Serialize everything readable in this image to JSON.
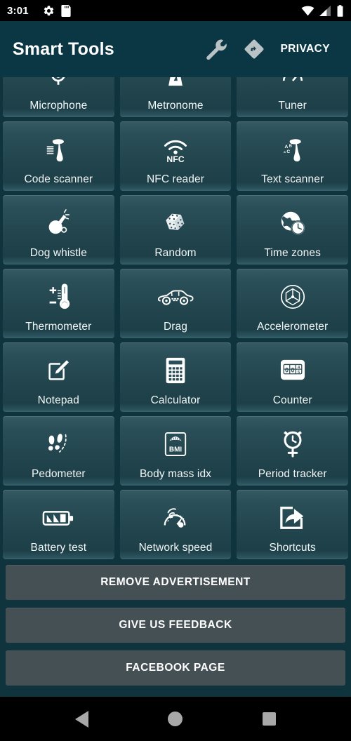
{
  "status_bar": {
    "time": "3:01",
    "left_icons": [
      {
        "name": "settings-gear-icon"
      },
      {
        "name": "sd-card-icon"
      }
    ],
    "right_icons": [
      {
        "name": "wifi-icon"
      },
      {
        "name": "cellular-signal-icon"
      },
      {
        "name": "battery-icon"
      }
    ]
  },
  "app_bar": {
    "title": "Smart Tools",
    "actions": [
      {
        "name": "wrench-icon",
        "label": ""
      },
      {
        "name": "navigation-diamond-icon",
        "label": ""
      }
    ],
    "privacy_label": "PRIVACY"
  },
  "grid": {
    "tiles": [
      {
        "label": "Microphone",
        "icon": "microphone-icon"
      },
      {
        "label": "Metronome",
        "icon": "metronome-icon"
      },
      {
        "label": "Tuner",
        "icon": "tuner-icon"
      },
      {
        "label": "Code scanner",
        "icon": "barcode-scanner-icon"
      },
      {
        "label": "NFC reader",
        "icon": "nfc-icon"
      },
      {
        "label": "Text scanner",
        "icon": "text-scanner-icon"
      },
      {
        "label": "Dog whistle",
        "icon": "whistle-icon"
      },
      {
        "label": "Random",
        "icon": "dice-icon"
      },
      {
        "label": "Time zones",
        "icon": "globe-clock-icon"
      },
      {
        "label": "Thermometer",
        "icon": "thermometer-icon"
      },
      {
        "label": "Drag",
        "icon": "car-icon"
      },
      {
        "label": "Accelerometer",
        "icon": "accelerometer-icon"
      },
      {
        "label": "Notepad",
        "icon": "notepad-pencil-icon"
      },
      {
        "label": "Calculator",
        "icon": "calculator-icon"
      },
      {
        "label": "Counter",
        "icon": "counter-icon"
      },
      {
        "label": "Pedometer",
        "icon": "footsteps-icon"
      },
      {
        "label": "Body mass idx",
        "icon": "bmi-scale-icon"
      },
      {
        "label": "Period tracker",
        "icon": "alarm-clock-venus-icon"
      },
      {
        "label": "Battery test",
        "icon": "battery-test-icon"
      },
      {
        "label": "Network speed",
        "icon": "speedometer-wifi-icon"
      },
      {
        "label": "Shortcuts",
        "icon": "share-arrow-icon"
      }
    ]
  },
  "footer": {
    "buttons": [
      {
        "label": "REMOVE ADVERTISEMENT",
        "name": "remove-advertisement-button"
      },
      {
        "label": "GIVE US FEEDBACK",
        "name": "give-us-feedback-button"
      },
      {
        "label": "FACEBOOK PAGE",
        "name": "facebook-page-button"
      }
    ]
  },
  "nav_bar": {
    "back": "back-button",
    "home": "home-button",
    "recents": "recents-button"
  },
  "colors": {
    "background": "#0f343d",
    "app_bar": "#0b3744",
    "tile": "#254a53",
    "footer_button": "#455055",
    "text": "#ffffff"
  }
}
